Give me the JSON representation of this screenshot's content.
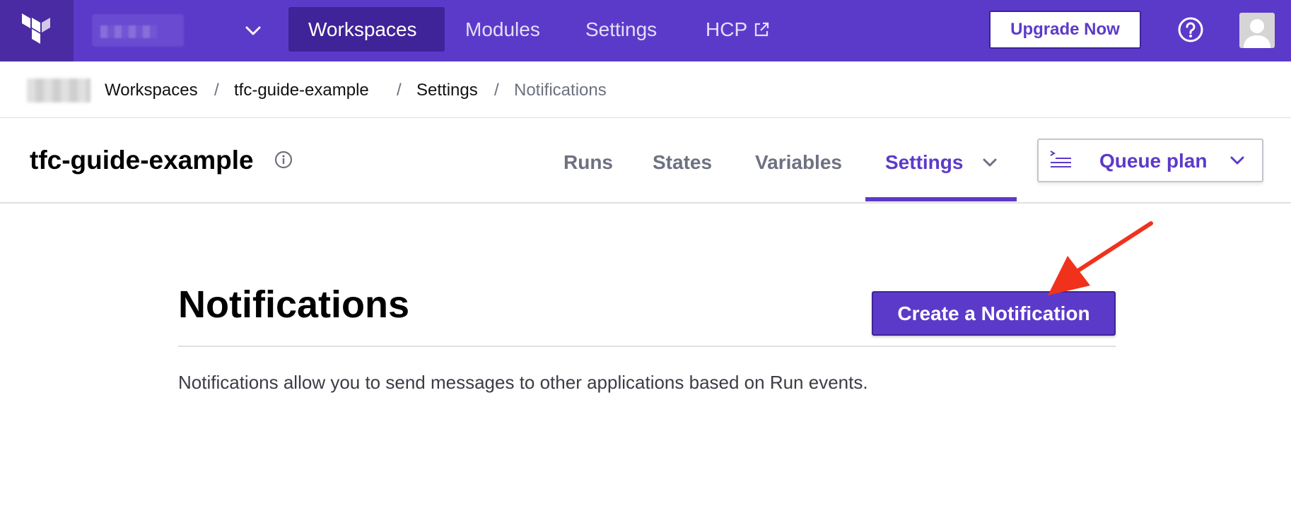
{
  "topnav": {
    "items": [
      {
        "label": "Workspaces"
      },
      {
        "label": "Modules"
      },
      {
        "label": "Settings"
      },
      {
        "label": "HCP"
      }
    ],
    "upgrade_label": "Upgrade Now",
    "logo_icon": "terraform-logo-icon",
    "help_icon": "question-circle-icon",
    "avatar_icon": "user-avatar-icon"
  },
  "breadcrumb": {
    "items": [
      "Workspaces",
      "tfc-guide-example",
      "Settings",
      "Notifications"
    ],
    "separator": "/"
  },
  "workspace": {
    "title": "tfc-guide-example",
    "tabs": [
      {
        "label": "Runs"
      },
      {
        "label": "States"
      },
      {
        "label": "Variables"
      },
      {
        "label": "Settings",
        "active": true
      }
    ],
    "queue_plan_label": "Queue plan"
  },
  "main": {
    "title": "Notifications",
    "create_button_label": "Create a Notification",
    "description": "Notifications allow you to send messages to other applications based on Run events."
  },
  "colors": {
    "brand": "#5c3ac9",
    "brand_dark": "#3f2398",
    "annotation_arrow": "#f0321c"
  }
}
